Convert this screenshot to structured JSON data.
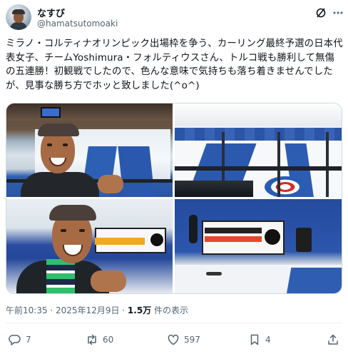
{
  "user": {
    "name": "なすび",
    "handle": "@hamatsutomoaki"
  },
  "post": {
    "text": "ミラノ・コルティナオリンピック出場枠を争う、カーリング最終予選の日本代表女子、チームYoshimura・フォルティウスさん、トルコ戦も勝利して無傷の五連勝！初観戦でしたので、色んな意味で気持ちも落ち着きませんでしたが、見事な勝ち方でホッと致しました(^o^)",
    "timestamp": "午前10:35 · 2025年12月9日 · ",
    "views_count": "1.5万",
    "views_suffix": " 件の表示"
  },
  "photos": {
    "scoreboard_brand": "KELOWNA"
  },
  "actions": {
    "replies": "7",
    "reposts": "60",
    "likes": "597",
    "bookmarks": "4"
  },
  "icons": {
    "grok": "grok-icon",
    "more": "more-icon",
    "reply": "reply-icon",
    "repost": "repost-icon",
    "like": "heart-icon",
    "bookmark": "bookmark-icon",
    "share": "share-icon"
  },
  "colors": {
    "text": "#0f1419",
    "secondary": "#536471",
    "border": "#cfd9de"
  }
}
